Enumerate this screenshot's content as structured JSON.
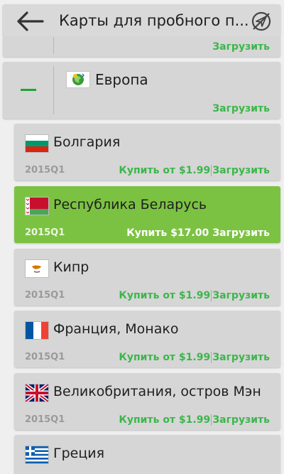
{
  "header": {
    "title": "Карты для пробного п...",
    "back_icon": "arrow-left-icon",
    "gps_icon": "gps-off-icon"
  },
  "partial_item": {
    "download_label": "Загрузить"
  },
  "region": {
    "name": "Европа",
    "icon": "globe-europe-icon",
    "download_label": "Загрузить",
    "collapse_icon": "minus-icon"
  },
  "colors": {
    "accent_green": "#3cb64b",
    "selected_bg": "#7cc242",
    "card_bg": "#d6d6d6"
  },
  "countries": [
    {
      "name": "Болгария",
      "version": "2015Q1",
      "buy_label": "Купить от $1.99",
      "download_label": "Загрузить",
      "flag": "flag-bulgaria-icon"
    },
    {
      "name": "Республика Беларусь",
      "version": "2015Q1",
      "buy_label": "Купить $17.00",
      "download_label": "Загрузить",
      "flag": "flag-belarus-icon",
      "selected": true
    },
    {
      "name": "Кипр",
      "version": "2015Q1",
      "buy_label": "Купить от $1.99",
      "download_label": "Загрузить",
      "flag": "flag-cyprus-icon"
    },
    {
      "name": "Франция, Монако",
      "version": "2015Q1",
      "buy_label": "Купить от $1.99",
      "download_label": "Загрузить",
      "flag": "flag-france-icon"
    },
    {
      "name": "Великобритания, остров Мэн",
      "version": "2015Q1",
      "buy_label": "Купить от $1.99",
      "download_label": "Загрузить",
      "flag": "flag-uk-icon"
    },
    {
      "name": "Греция",
      "flag": "flag-greece-icon"
    }
  ]
}
